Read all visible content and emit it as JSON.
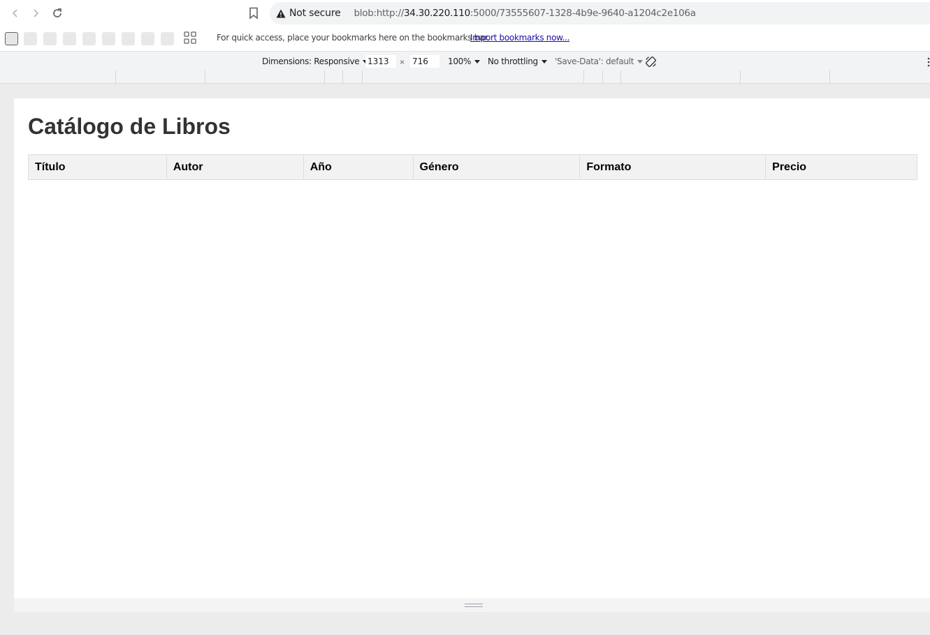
{
  "browser": {
    "security_label": "Not secure",
    "url_prefix": "blob:http://",
    "url_host": "34.30.220.110",
    "url_rest": ":5000/73555607-1328-4b9e-9640-a1204c2e106a",
    "bookmarks_hint": "For quick access, place your bookmarks here on the bookmarks bar.",
    "bookmarks_import": "Import bookmarks now..."
  },
  "devtools": {
    "dimensions_label": "Dimensions: Responsive",
    "width_value": "1313",
    "times": "×",
    "height_value": "716",
    "zoom": "100%",
    "throttling": "No throttling",
    "save_data": "'Save-Data': default"
  },
  "page": {
    "title": "Catálogo de Libros",
    "table": {
      "headers": [
        "Título",
        "Autor",
        "Año",
        "Género",
        "Formato",
        "Precio"
      ]
    }
  },
  "colors": {
    "heading": "#333333",
    "table_header_bg": "#f2f2f2",
    "link": "#1a0dab"
  }
}
